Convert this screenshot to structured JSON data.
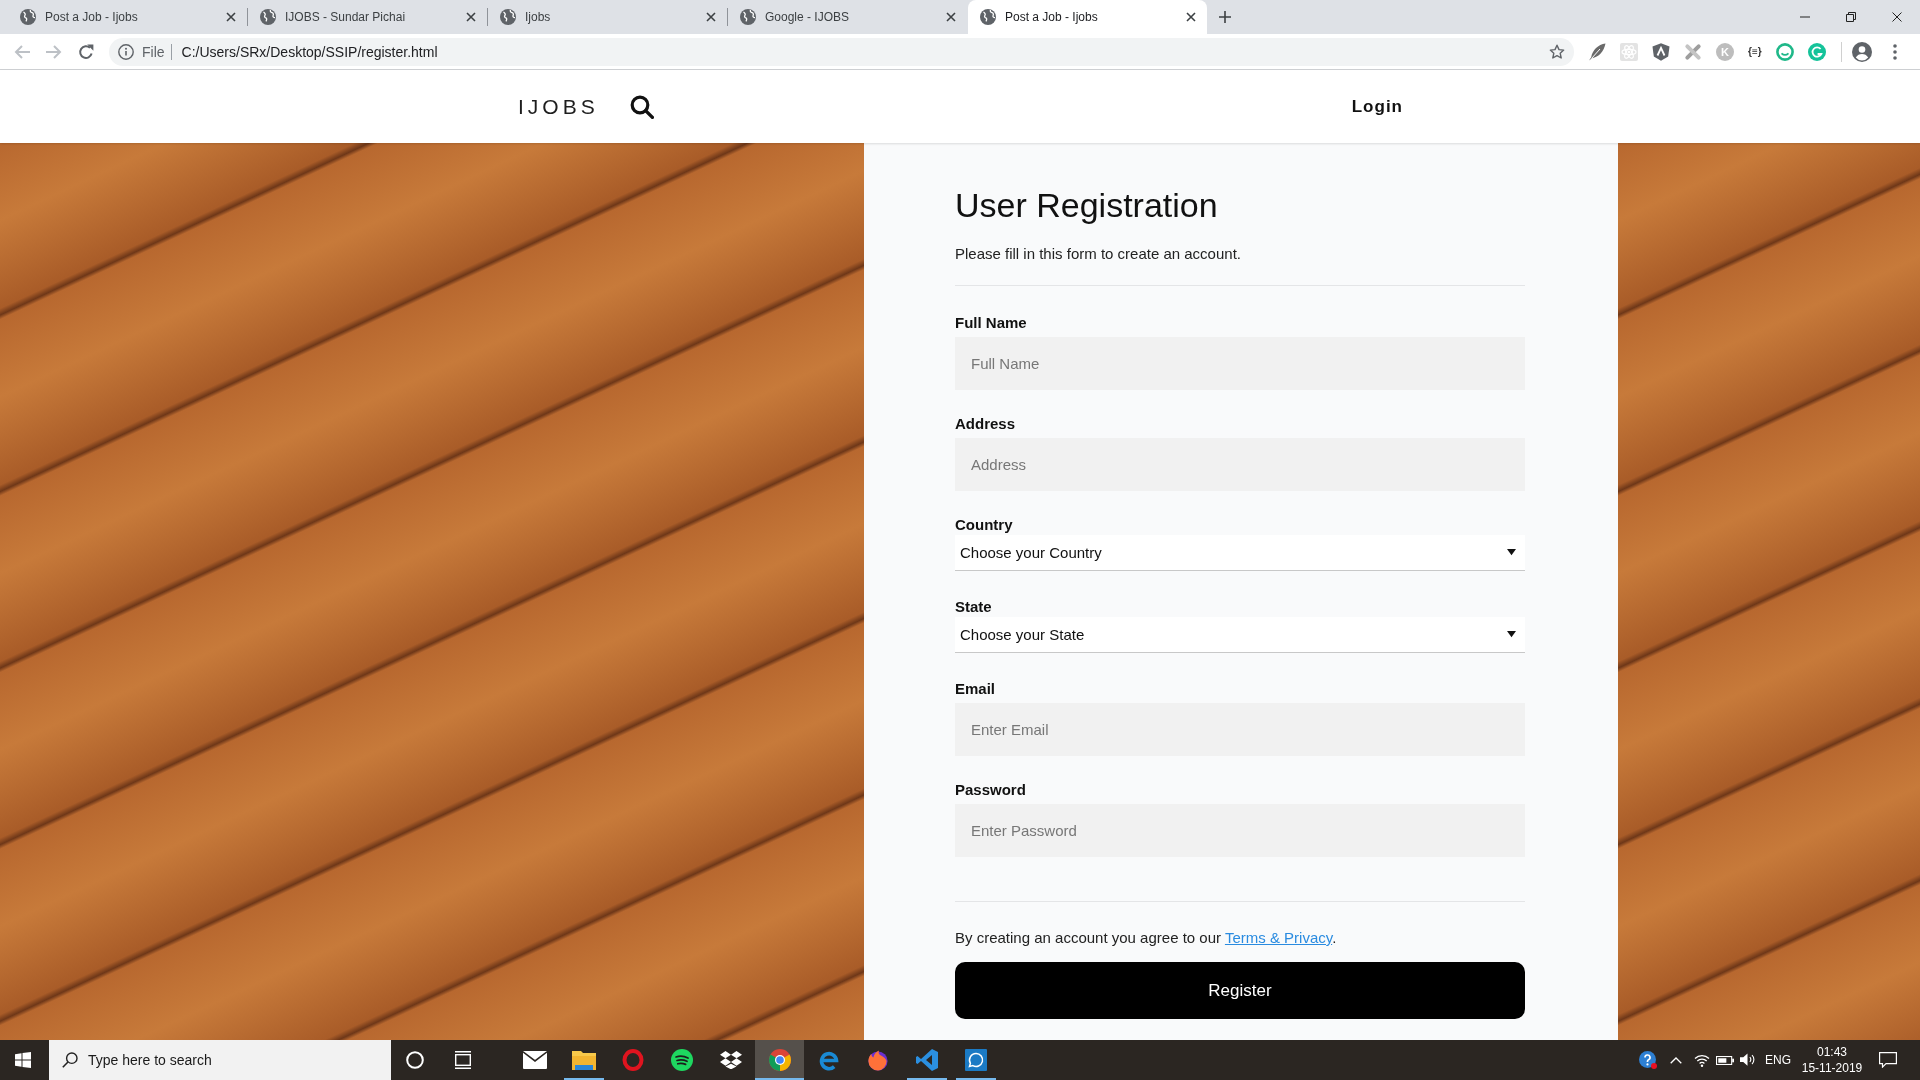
{
  "browser": {
    "tabs": [
      {
        "title": "Post a Job - Ijobs",
        "selected": false
      },
      {
        "title": "IJOBS - Sundar Pichai",
        "selected": false
      },
      {
        "title": "Ijobs",
        "selected": false
      },
      {
        "title": "Google - IJOBS",
        "selected": false
      },
      {
        "title": "Post a Job - Ijobs",
        "selected": true
      }
    ],
    "address_bar": {
      "scheme": "File",
      "url": "C:/Users/SRx/Desktop/SSIP/register.html"
    },
    "extensions": [
      {
        "kind": "feather"
      },
      {
        "kind": "atom"
      },
      {
        "kind": "shield"
      },
      {
        "kind": "strips"
      },
      {
        "kind": "letter",
        "label": "K"
      },
      {
        "kind": "text",
        "label": "{≡}"
      },
      {
        "kind": "ring"
      },
      {
        "kind": "arc"
      }
    ]
  },
  "header": {
    "logo": "IJOBS",
    "login": "Login"
  },
  "form": {
    "title": "User Registration",
    "subtitle": "Please fill in this form to create an account.",
    "fields": [
      {
        "kind": "input",
        "label": "Full Name",
        "placeholder": "Full Name"
      },
      {
        "kind": "input",
        "label": "Address",
        "placeholder": "Address"
      },
      {
        "kind": "select",
        "label": "Country",
        "value": "Choose your Country"
      },
      {
        "kind": "select",
        "label": "State",
        "value": "Choose your State"
      },
      {
        "kind": "input",
        "label": "Email",
        "placeholder": "Enter Email"
      },
      {
        "kind": "input",
        "label": "Password",
        "placeholder": "Enter Password"
      }
    ],
    "agreement": {
      "text": "By creating an account you agree to our",
      "link": "Terms & Privacy",
      "end": "."
    },
    "submit": "Register"
  },
  "taskbar": {
    "search_placeholder": "Type here to search",
    "apps": [
      {
        "kind": "mail",
        "selected": false,
        "running": false
      },
      {
        "kind": "folder",
        "selected": false,
        "running": true
      },
      {
        "kind": "ring",
        "selected": false,
        "running": false
      },
      {
        "kind": "waves",
        "selected": false,
        "running": false
      },
      {
        "kind": "diamonds",
        "selected": false,
        "running": false
      },
      {
        "kind": "segments",
        "selected": true,
        "running": true
      },
      {
        "kind": "swirl",
        "selected": false,
        "running": false
      },
      {
        "kind": "flame",
        "selected": false,
        "running": false
      },
      {
        "kind": "ribbon",
        "selected": false,
        "running": true
      },
      {
        "kind": "chat",
        "selected": false,
        "running": true
      }
    ],
    "language": "ENG",
    "time": "01:43",
    "date": "15-11-2019"
  }
}
